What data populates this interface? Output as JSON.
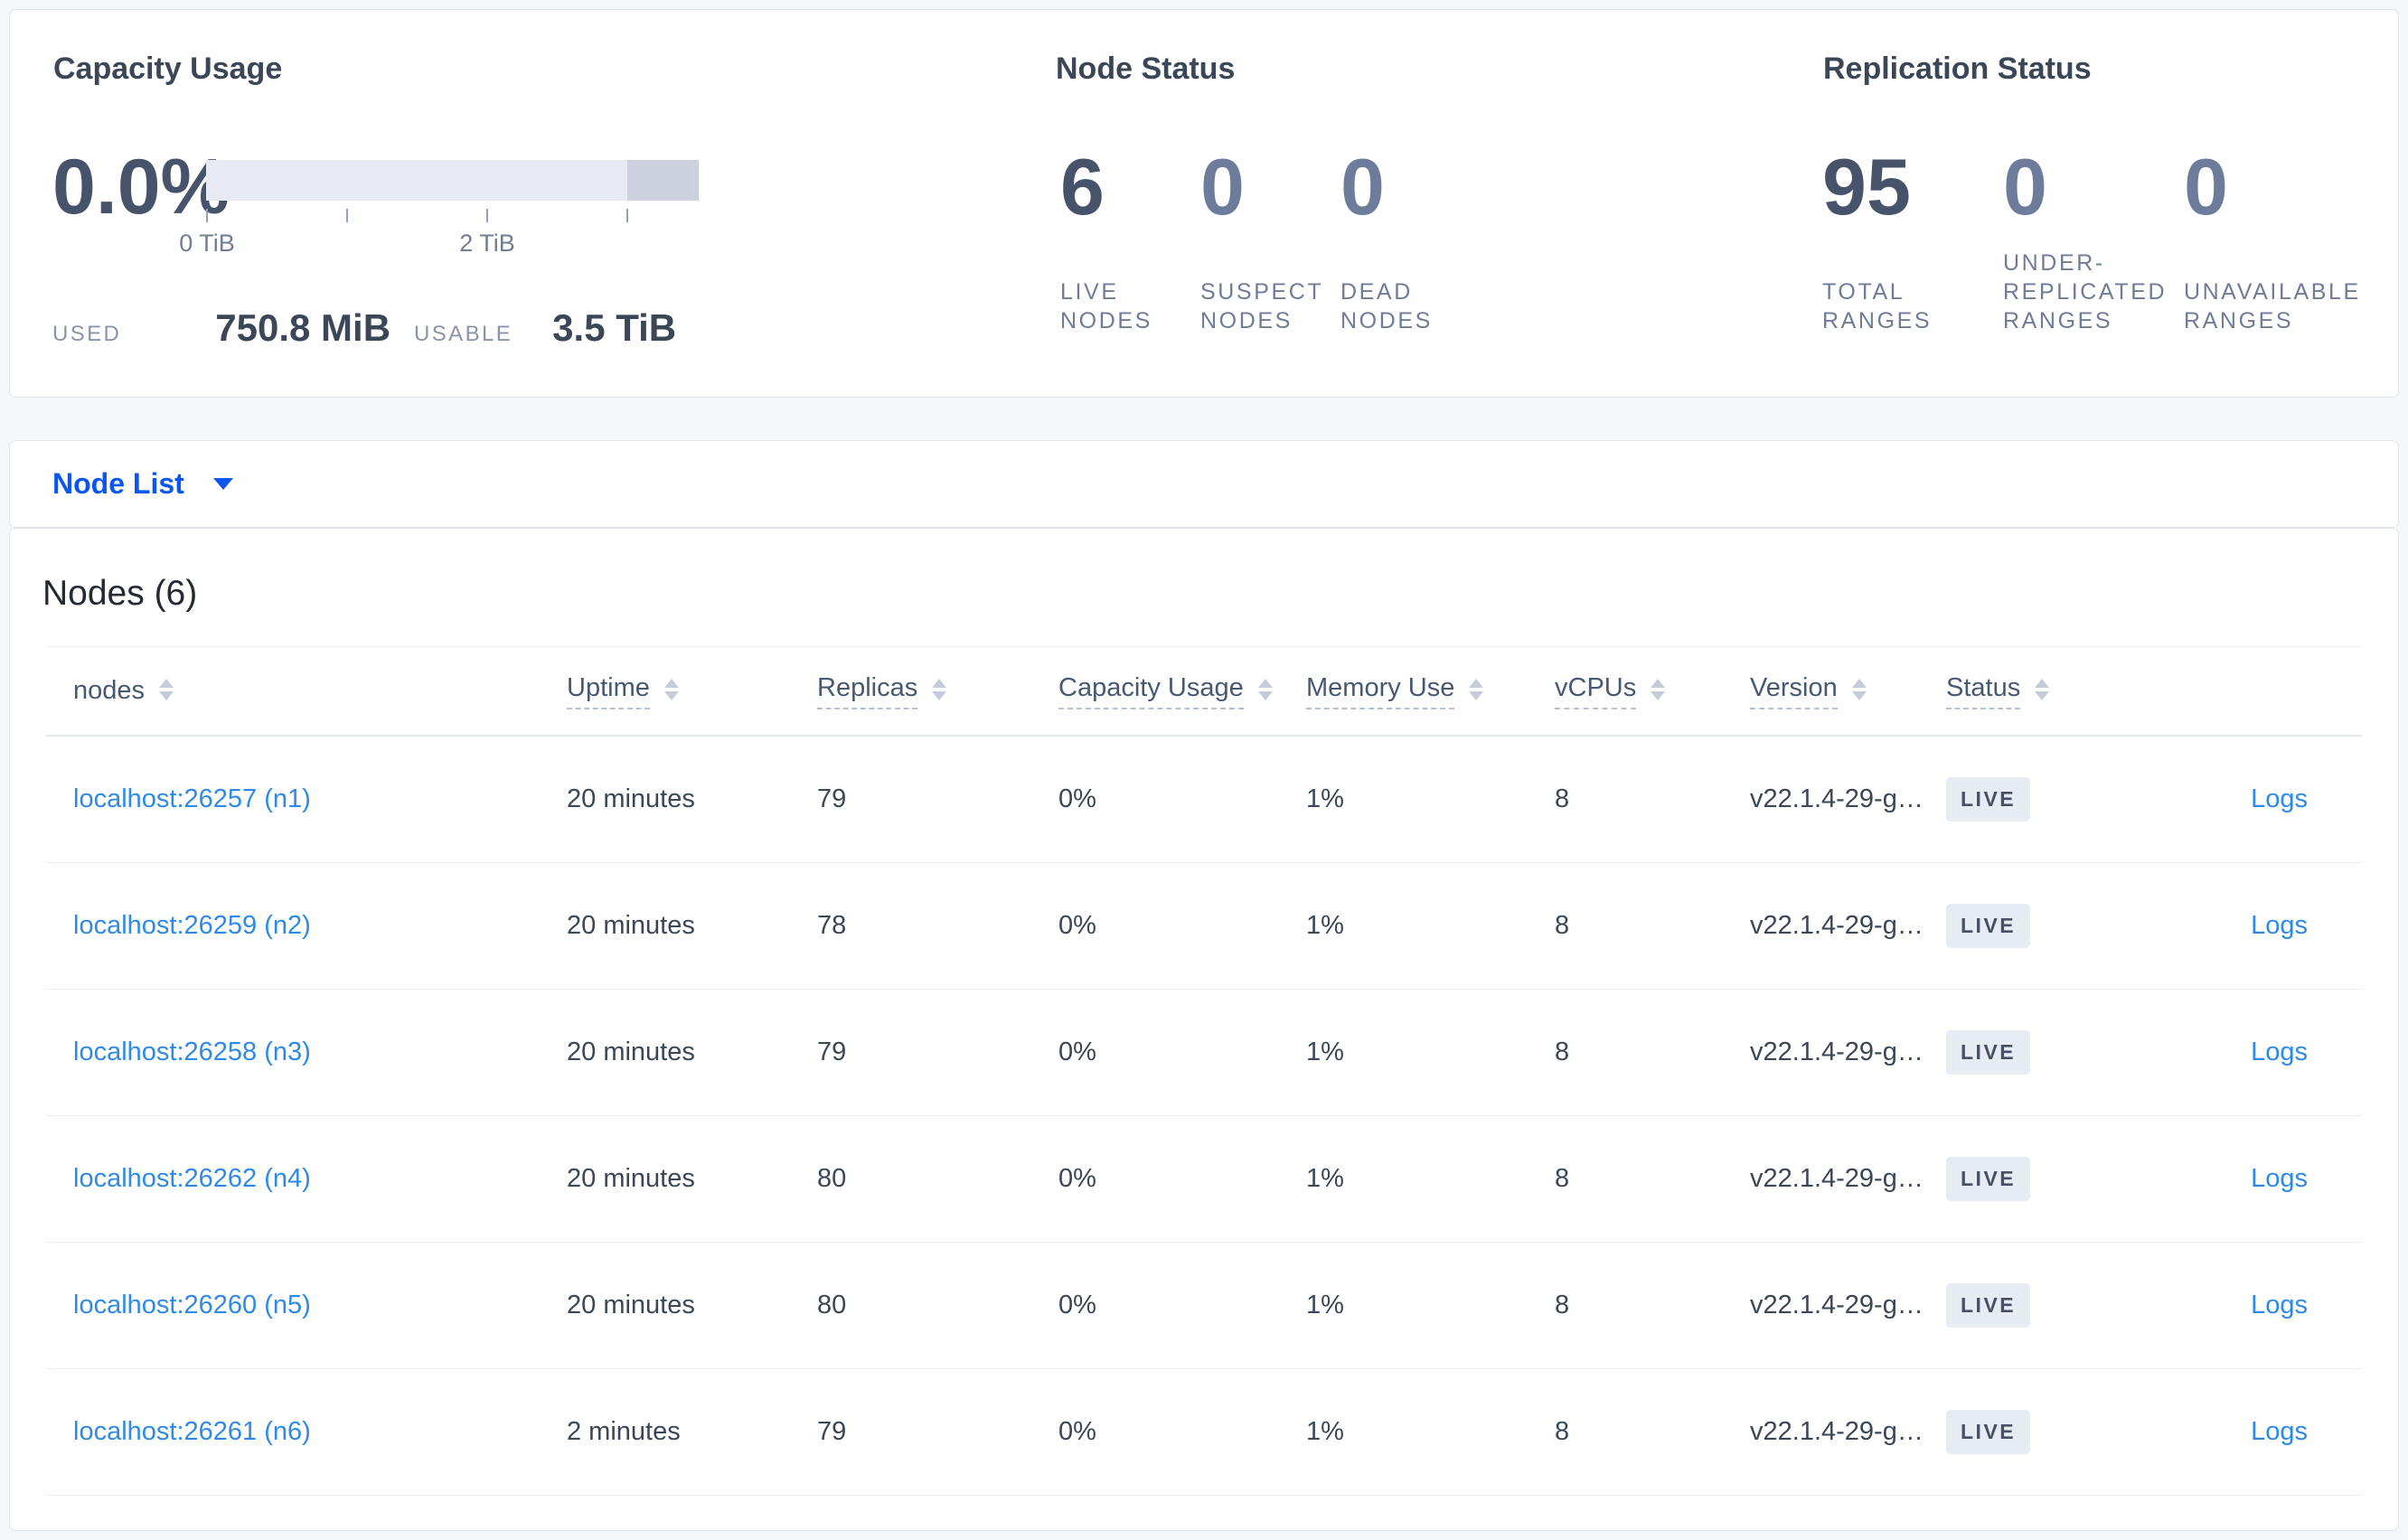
{
  "colors": {
    "page_bg": "#f4f6fa",
    "card_bg": "#ffffff",
    "heading_dark": "#3b4656",
    "big_number_dark": "#46536b",
    "big_number_muted": "#6e7c9c",
    "label_muted": "#6f7b97",
    "bar_light": "#e7e9f3",
    "bar_dark": "#cdd1de",
    "node_list_blue": "#0a56f2",
    "table_link_blue": "#2e8ae4",
    "badge_bg": "#e7ebf2",
    "badge_text": "#475064"
  },
  "capacity_panel": {
    "title": "Capacity Usage",
    "percent": "0.0%",
    "tick_label_0": "0 TiB",
    "tick_label_2": "2 TiB",
    "used_label": "USED",
    "used_value": "750.8 MiB",
    "usable_label": "USABLE",
    "usable_value": "3.5 TiB"
  },
  "node_status_panel": {
    "title": "Node Status",
    "metrics": [
      {
        "value": "6",
        "label": "LIVE NODES"
      },
      {
        "value": "0",
        "label": "SUSPECT NODES"
      },
      {
        "value": "0",
        "label": "DEAD NODES"
      }
    ]
  },
  "replication_panel": {
    "title": "Replication Status",
    "metrics": [
      {
        "value": "95",
        "label": "TOTAL RANGES"
      },
      {
        "value": "0",
        "label": "UNDER-REPLICATED RANGES"
      },
      {
        "value": "0",
        "label": "UNAVAILABLE RANGES"
      }
    ]
  },
  "node_list_bar": {
    "label": "Node List"
  },
  "nodes_section": {
    "heading": "Nodes (6)",
    "columns": [
      {
        "label": "nodes"
      },
      {
        "label": "Uptime"
      },
      {
        "label": "Replicas"
      },
      {
        "label": "Capacity Usage"
      },
      {
        "label": "Memory Use"
      },
      {
        "label": "vCPUs"
      },
      {
        "label": "Version"
      },
      {
        "label": "Status"
      }
    ],
    "rows": [
      {
        "node": "localhost:26257 (n1)",
        "uptime": "20 minutes",
        "replicas": "79",
        "capacity": "0%",
        "memory": "1%",
        "vcpus": "8",
        "version": "v22.1.4-29-g…",
        "status": "LIVE",
        "logs": "Logs"
      },
      {
        "node": "localhost:26259 (n2)",
        "uptime": "20 minutes",
        "replicas": "78",
        "capacity": "0%",
        "memory": "1%",
        "vcpus": "8",
        "version": "v22.1.4-29-g…",
        "status": "LIVE",
        "logs": "Logs"
      },
      {
        "node": "localhost:26258 (n3)",
        "uptime": "20 minutes",
        "replicas": "79",
        "capacity": "0%",
        "memory": "1%",
        "vcpus": "8",
        "version": "v22.1.4-29-g…",
        "status": "LIVE",
        "logs": "Logs"
      },
      {
        "node": "localhost:26262 (n4)",
        "uptime": "20 minutes",
        "replicas": "80",
        "capacity": "0%",
        "memory": "1%",
        "vcpus": "8",
        "version": "v22.1.4-29-g…",
        "status": "LIVE",
        "logs": "Logs"
      },
      {
        "node": "localhost:26260 (n5)",
        "uptime": "20 minutes",
        "replicas": "80",
        "capacity": "0%",
        "memory": "1%",
        "vcpus": "8",
        "version": "v22.1.4-29-g…",
        "status": "LIVE",
        "logs": "Logs"
      },
      {
        "node": "localhost:26261 (n6)",
        "uptime": "2 minutes",
        "replicas": "79",
        "capacity": "0%",
        "memory": "1%",
        "vcpus": "8",
        "version": "v22.1.4-29-g…",
        "status": "LIVE",
        "logs": "Logs"
      }
    ]
  }
}
